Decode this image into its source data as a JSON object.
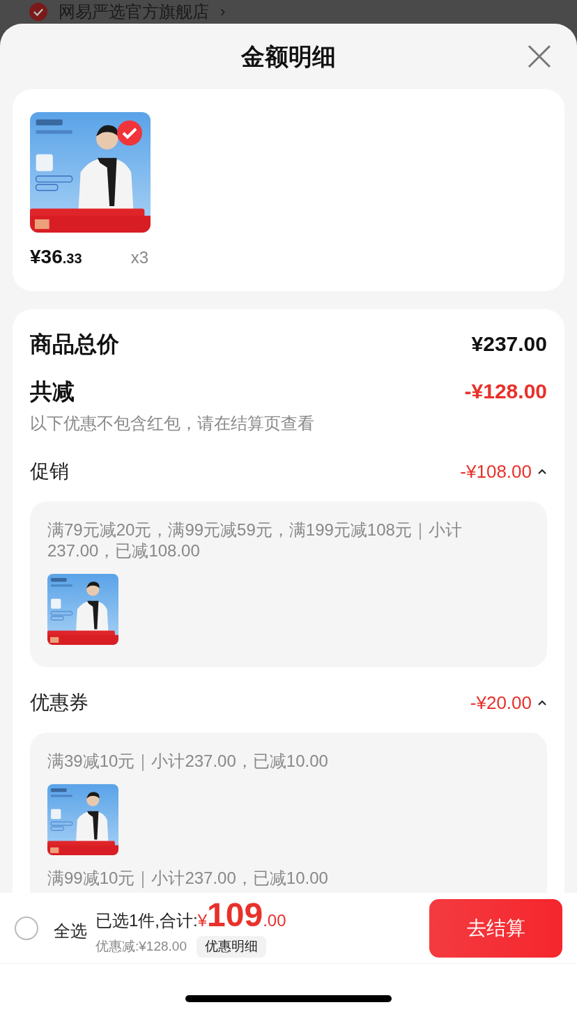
{
  "background_page": {
    "store_name": "网易严选官方旗舰店",
    "chevron": "›"
  },
  "sheet": {
    "title": "金额明细"
  },
  "product": {
    "selected": true,
    "price_main": "¥36",
    "price_decimal": ".33",
    "quantity": "x3"
  },
  "summary": [
    {
      "kind": "total",
      "label": "商品总价",
      "amount": "¥237.00"
    },
    {
      "kind": "discount",
      "label": "共减",
      "amount": "-¥128.00",
      "note": "以下优惠不包含红包，请在结算页查看"
    }
  ],
  "sections": [
    {
      "title": "促销",
      "amount": "-¥108.00",
      "expanded": true,
      "entries": [
        {
          "kind": "text",
          "text": "满79元减20元，满99元减59元，满199元减108元｜小计237.00，已减108.00"
        },
        {
          "kind": "picture"
        }
      ]
    },
    {
      "title": "优惠券",
      "amount": "-¥20.00",
      "expanded": true,
      "entries": [
        {
          "kind": "text",
          "text": "满39减10元｜小计237.00，已减10.00"
        },
        {
          "kind": "picture"
        },
        {
          "kind": "text",
          "text": "满99减10元｜小计237.00，已减10.00"
        }
      ]
    }
  ],
  "footer": {
    "select_all": {
      "label": "全选",
      "checked": false
    },
    "summary_label": "已选1件,合计:",
    "currency": "¥",
    "total_main": "109",
    "total_decimal": ".00",
    "discount_label": "优惠减:¥128.00",
    "details_chip": "优惠明细",
    "checkout": "去结算"
  }
}
